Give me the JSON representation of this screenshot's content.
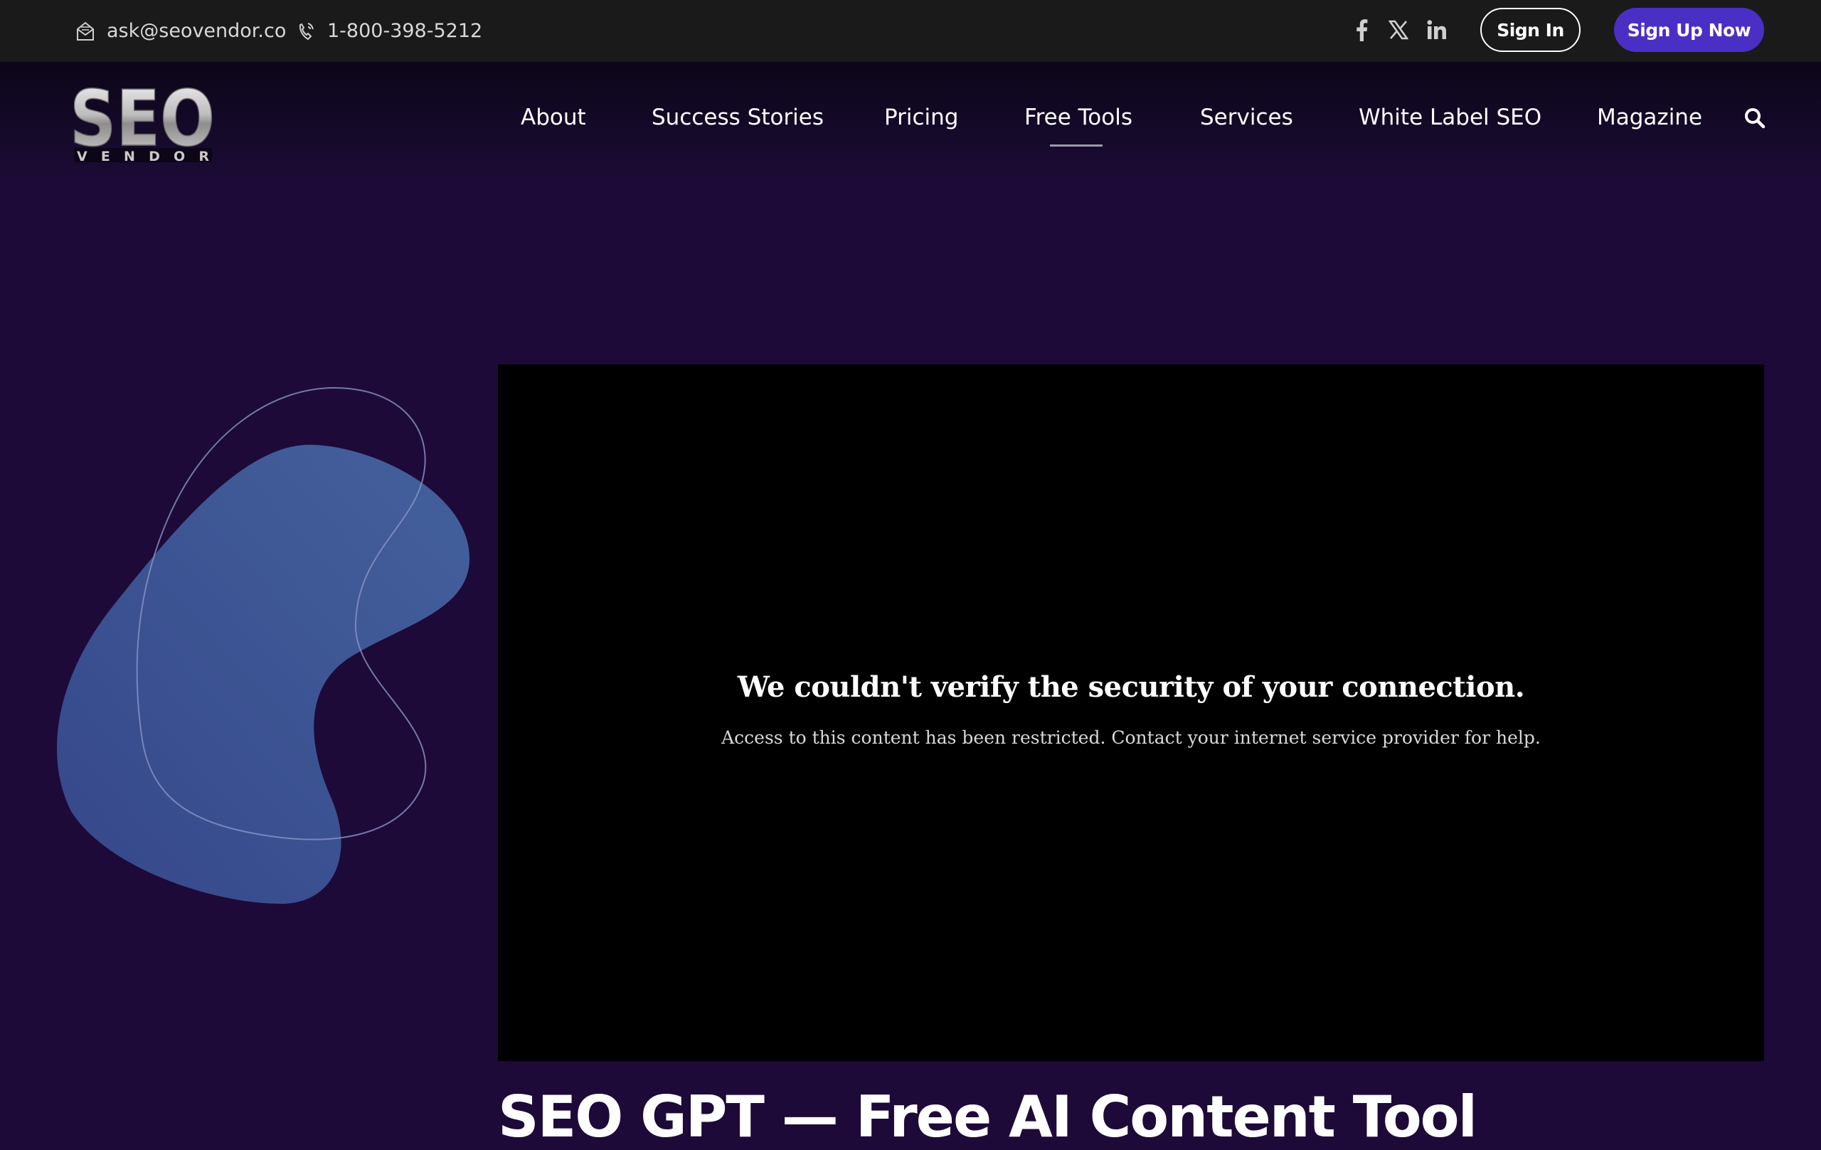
{
  "topbar": {
    "email": "ask@seovendor.co",
    "phone": "1-800-398-5212",
    "social": [
      {
        "name": "facebook-icon"
      },
      {
        "name": "x-icon"
      },
      {
        "name": "linkedin-icon"
      }
    ],
    "signin_label": "Sign In",
    "signup_label": "Sign Up Now"
  },
  "logo": {
    "text": "SEO",
    "subtext": "VENDOR"
  },
  "nav": {
    "items": [
      {
        "label": "About"
      },
      {
        "label": "Success Stories"
      },
      {
        "label": "Pricing"
      },
      {
        "label": "Free Tools",
        "active": true
      },
      {
        "label": "Services"
      },
      {
        "label": "White Label SEO"
      },
      {
        "label": "Magazine"
      }
    ],
    "search_icon": "search-icon"
  },
  "video": {
    "title": "We couldn't verify the security of your connection.",
    "message": "Access to this content has been restricted. Contact your internet service provider for help."
  },
  "page": {
    "heading": "SEO GPT — Free AI Content Tool"
  },
  "colors": {
    "topbar_bg": "#1a1a1a",
    "page_bg": "#1d0a38",
    "accent": "#4a2fc4",
    "blob": "#3c5590"
  }
}
